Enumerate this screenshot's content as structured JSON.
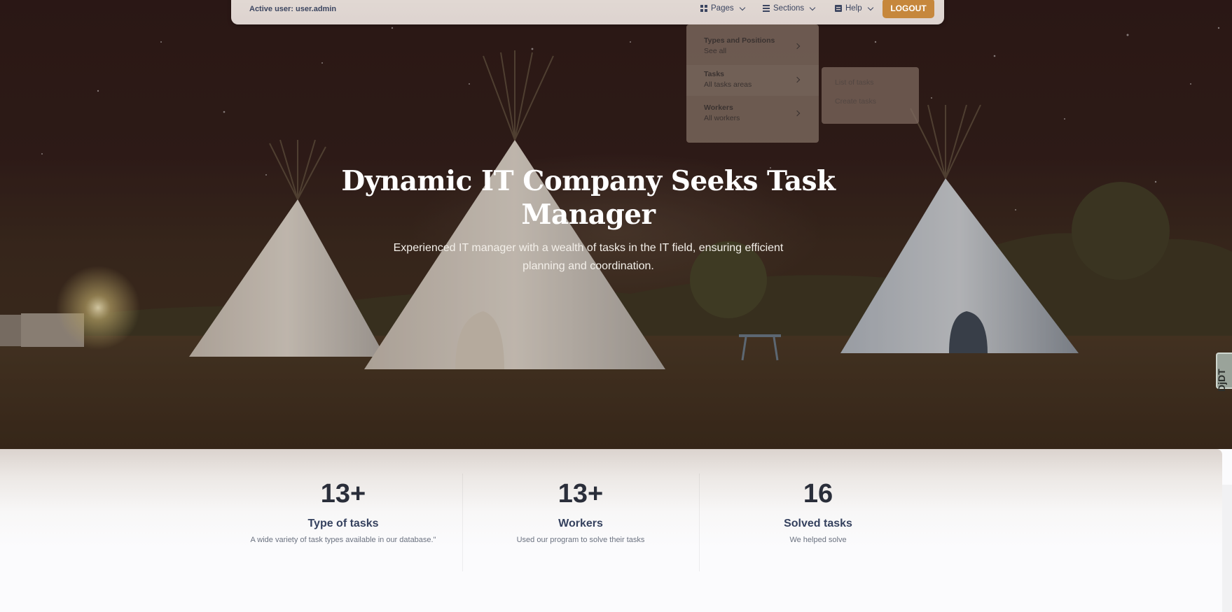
{
  "navbar": {
    "active_user": "Active user: user.admin",
    "menu": [
      {
        "label": "Pages",
        "icon": "pages-icon"
      },
      {
        "label": "Sections",
        "icon": "sections-icon"
      },
      {
        "label": "Help",
        "icon": "help-icon"
      }
    ],
    "logout_label": "LOGOUT"
  },
  "dropdown": {
    "items": [
      {
        "title": "Types and Positions",
        "subtitle": "See all"
      },
      {
        "title": "Tasks",
        "subtitle": "All tasks areas"
      },
      {
        "title": "Workers",
        "subtitle": "All workers"
      }
    ],
    "submenu": [
      "List of tasks",
      "Create tasks"
    ]
  },
  "hero": {
    "title": "Dynamic IT Company Seeks Task Manager",
    "subtitle": "Experienced IT manager with a wealth of tasks in the IT field, ensuring efficient planning and coordination."
  },
  "stats": [
    {
      "number": "13+",
      "label": "Type of tasks",
      "description": "A wide variety of task types available in our database.\""
    },
    {
      "number": "13+",
      "label": "Workers",
      "description": "Used our program to solve their tasks"
    },
    {
      "number": "16",
      "label": "Solved tasks",
      "description": "We helped solve"
    }
  ],
  "side_tab": "DjDT",
  "colors": {
    "accent": "#c6873c",
    "navbar_bg": "#ddd3cf",
    "text_dark": "#35415e"
  }
}
